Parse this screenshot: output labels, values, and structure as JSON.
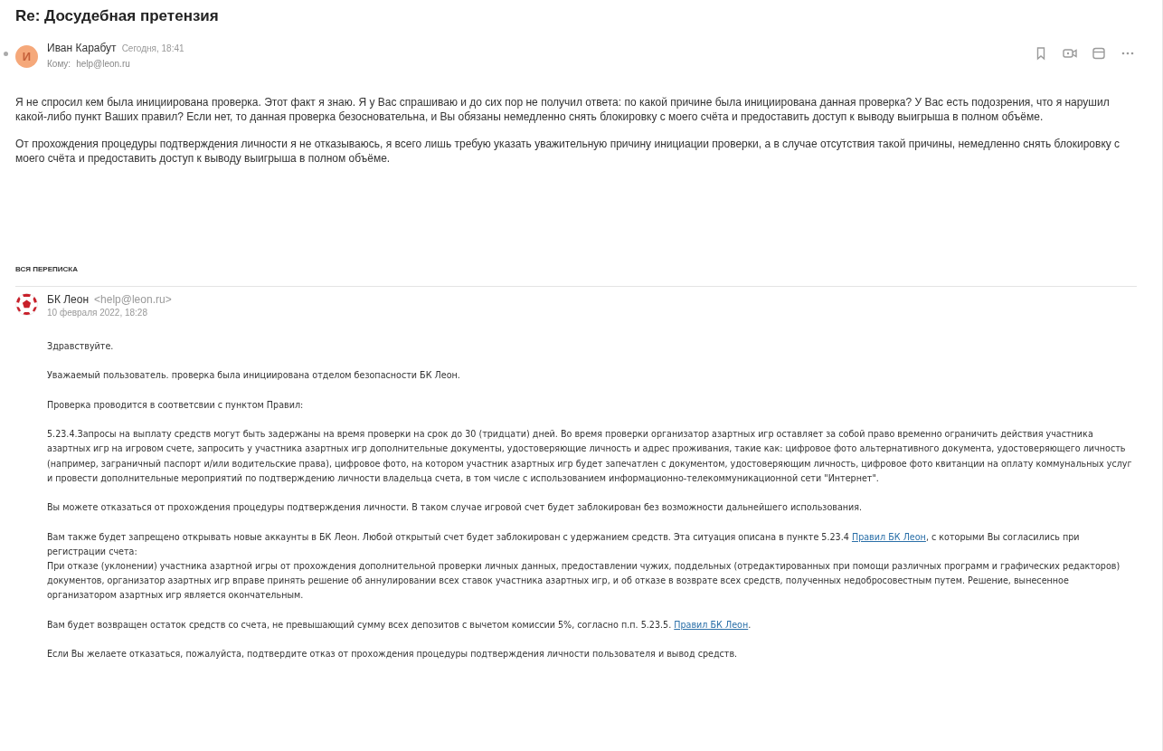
{
  "subject": "Re: Досудебная претензия",
  "message": {
    "unread": true,
    "avatar_letter": "И",
    "sender": "Иван Карабут",
    "time": "Сегодня, 18:41",
    "to_label": "Кому:",
    "to": "help@leon.ru",
    "paragraphs": [
      "Я не спросил кем была инициирована проверка. Этот факт я знаю. Я у Вас спрашиваю и до сих пор не получил ответа: по какой причине была инициирована данная проверка? У Вас есть подозрения, что я нарушил какой-либо пункт Ваших правил? Если нет, то данная проверка безосновательна, и Вы обязаны немедленно снять блокировку с моего счёта и предоставить доступ к выводу выигрыша в полном объёме.",
      "От прохождения процедуры подтверждения личности я не отказываюсь, я всего лишь требую указать уважительную причину инициации проверки, а в случае отсутствия такой причины, немедленно снять блокировку с моего счёта и предоставить доступ к выводу выигрыша в полном объёме."
    ]
  },
  "thread_label": "ВСЯ ПЕРЕПИСКА",
  "quoted": {
    "sender": "БК Леон",
    "address": "<help@leon.ru>",
    "date": "10 февраля 2022, 18:28",
    "paragraphs": [
      {
        "lines": [
          [
            {
              "kind": "text",
              "text": "Здравствуйте."
            }
          ]
        ]
      },
      {
        "lines": [
          [
            {
              "kind": "text",
              "text": "Уважаемый пользователь. проверка была инициирована отделом безопасности БК Леон."
            }
          ]
        ]
      },
      {
        "lines": [
          [
            {
              "kind": "text",
              "text": "Проверка проводится в соответсвии с пунктом Правил:"
            }
          ]
        ]
      },
      {
        "lines": [
          [
            {
              "kind": "text",
              "text": "5.23.4.Запросы на выплату средств могут быть задержаны на время проверки на срок до 30 (тридцати) дней. Во время проверки организатор азартных игр оставляет за собой право временно ограничить действия участника азартных игр на игровом счете, запросить у участника азартных игр дополнительные документы, удостоверяющие личность и адрес проживания, такие как: цифровое фото альтернативного документа, удостоверяющего личность (например, заграничный паспорт и/или водительские права), цифровое фото, на котором участник азартных игр будет запечатлен с документом, удостоверяющим личность, цифровое фото квитанции на оплату коммунальных услуг и провести дополнительные мероприятий по подтверждению личности владельца счета, в том числе с использованием информационно-телекоммуникационной сети \"Интернет\"."
            }
          ]
        ]
      },
      {
        "lines": [
          [
            {
              "kind": "text",
              "text": "Вы можете отказаться от прохождения процедуры подтверждения личности. В таком случае игровой счет будет заблокирован без возможности дальнейшего использования."
            }
          ]
        ]
      },
      {
        "lines": [
          [
            {
              "kind": "text",
              "text": "Вам также будет запрещено открывать новые аккаунты в БК Леон. Любой открытый счет будет заблокирован с удержанием средств. Эта ситуация описана в пункте 5.23.4 "
            },
            {
              "kind": "link",
              "text": "Правил БК Леон"
            },
            {
              "kind": "text",
              "text": ", с которыми Вы согласились при регистрации счета:"
            }
          ],
          [
            {
              "kind": "text",
              "text": "При отказе (уклонении) участника азартной игры от прохождения дополнительной проверки личных данных, предоставлении чужих, поддельных (отредактированных при помощи различных программ и графических редакторов) документов, организатор азартных игр вправе принять решение об аннулировании всех ставок участника азартных игр, и об отказе в возврате всех средств, полученных недобросовестным путем. Решение, вынесенное организатором азартных игр является окончательным."
            }
          ]
        ]
      },
      {
        "lines": [
          [
            {
              "kind": "text",
              "text": "Вам будет возвращен остаток средств со счета, не превышающий сумму всех депозитов с вычетом комиссии 5%, согласно п.п. 5.23.5. "
            },
            {
              "kind": "link",
              "text": "Правил БК Леон"
            },
            {
              "kind": "text",
              "text": "."
            }
          ]
        ]
      },
      {
        "lines": [
          [
            {
              "kind": "text",
              "text": "Если Вы желаете отказаться, пожалуйста, подтвердите отказ от прохождения процедуры подтверждения личности пользователя и вывод средств."
            }
          ]
        ]
      }
    ]
  }
}
